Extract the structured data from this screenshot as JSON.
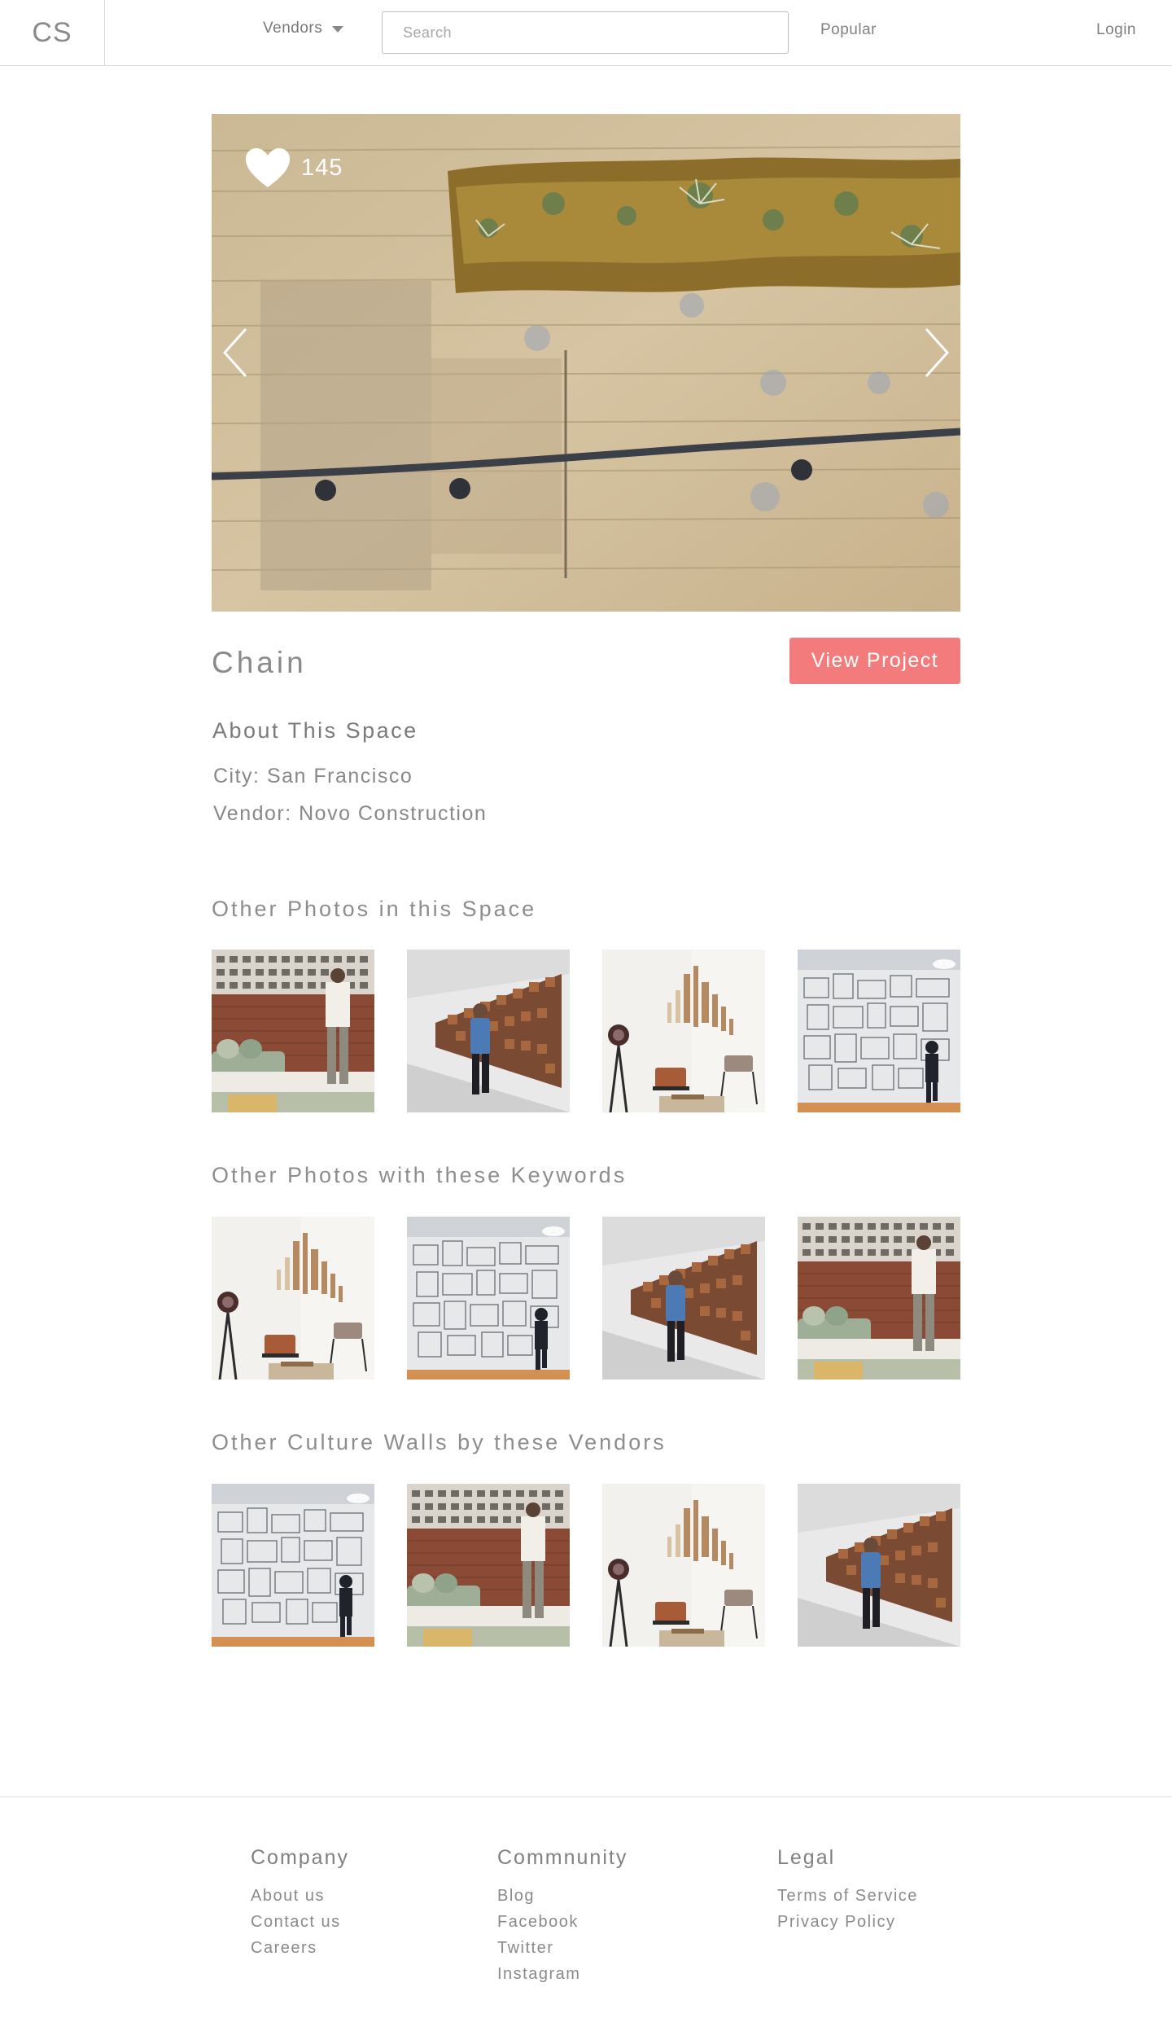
{
  "header": {
    "logo": "CS",
    "vendors_label": "Vendors",
    "search_placeholder": "Search",
    "popular_label": "Popular",
    "login_label": "Login"
  },
  "hero": {
    "like_count": "145",
    "icons": [
      "heart-icon",
      "chevron-left-icon",
      "chevron-right-icon"
    ]
  },
  "project": {
    "title": "Chain",
    "view_button": "View Project",
    "about_heading": "About This Space",
    "city_line": "City: San Francisco",
    "vendor_line": "Vendor: Novo Construction"
  },
  "sections": [
    {
      "heading": "Other Photos in this Space",
      "thumbs": [
        "brick",
        "hallway",
        "lounge",
        "framed"
      ]
    },
    {
      "heading": "Other Photos with these Keywords",
      "thumbs": [
        "lounge",
        "framed",
        "hallway",
        "brick"
      ]
    },
    {
      "heading": "Other Culture Walls by these Vendors",
      "thumbs": [
        "framed",
        "brick",
        "lounge",
        "hallway"
      ]
    }
  ],
  "footer": {
    "columns": [
      {
        "heading": "Company",
        "links": [
          "About us",
          "Contact us",
          "Careers"
        ]
      },
      {
        "heading": "Commnunity",
        "links": [
          "Blog",
          "Facebook",
          "Twitter",
          "Instagram"
        ]
      },
      {
        "heading": "Legal",
        "links": [
          "Terms of Service",
          "Privacy Policy"
        ]
      }
    ]
  },
  "colors": {
    "accent": "#f47b7b",
    "text": "#8a8a8a",
    "border": "#dcdcdc"
  }
}
